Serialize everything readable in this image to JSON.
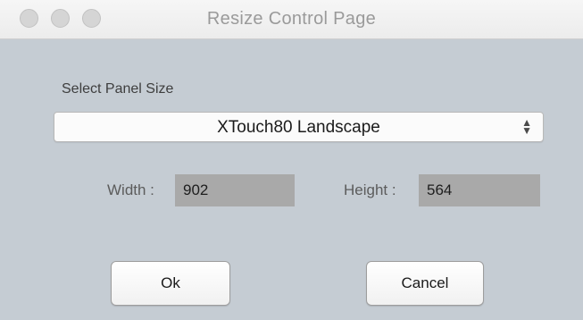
{
  "window": {
    "title": "Resize Control Page"
  },
  "panel_size": {
    "label": "Select Panel Size",
    "selected": "XTouch80 Landscape"
  },
  "dimensions": {
    "width_label": "Width :",
    "width_value": "902",
    "height_label": "Height :",
    "height_value": "564"
  },
  "buttons": {
    "ok_label": "Ok",
    "cancel_label": "Cancel"
  },
  "colors": {
    "window_background": "#c5ccd3",
    "field_background": "#a9a9a9",
    "title_text": "#9a9a9a"
  }
}
